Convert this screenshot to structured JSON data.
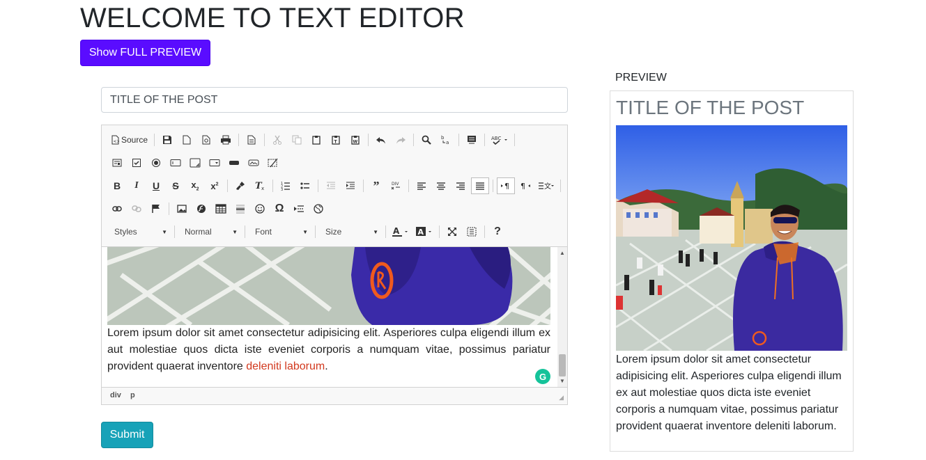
{
  "page": {
    "title": "WELCOME TO TEXT EDITOR",
    "full_preview_button": "Show FULL PREVIEW",
    "submit_button": "Submit"
  },
  "form": {
    "title_value": "TITLE OF THE POST"
  },
  "editor": {
    "source_label": "Source",
    "combos": {
      "styles": "Styles",
      "format": "Normal",
      "font": "Font",
      "size": "Size"
    },
    "content": {
      "body_text": "Lorem ipsum dolor sit amet consectetur adipisicing elit. Asperiores culpa eligendi illum ex aut molestiae quos dicta iste eveniet corporis a numquam vitae, possimus pariatur provident quaerat inventore ",
      "link_text": "deleniti laborum",
      "trailing": "."
    },
    "path": [
      "div",
      "p"
    ]
  },
  "preview": {
    "label": "PREVIEW",
    "title": "TITLE OF THE POST",
    "text": "Lorem ipsum dolor sit amet consectetur adipisicing elit. Asperiores culpa eligendi illum ex aut molestiae quos dicta iste eveniet corporis a numquam vitae, possimus pariatur provident quaerat inventore deleniti laborum."
  },
  "colors": {
    "primary": "#5a0cff",
    "submit": "#17a2b8",
    "link_red": "#d2391e",
    "grammarly": "#15c39a"
  }
}
